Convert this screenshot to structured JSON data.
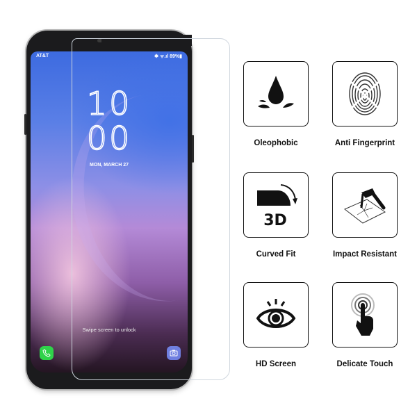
{
  "phone": {
    "carrier": "AT&T",
    "status_right": "✱ ᯤ.ıl 89%▮",
    "clock_hour": "10",
    "clock_minute": "00",
    "date": "MON, MARCH 27",
    "swipe_text": "Swipe screen to unlock",
    "apps": [
      "phone-icon",
      "camera-icon"
    ]
  },
  "features": [
    {
      "label": "Oleophobic",
      "icon": "oil-drop-icon"
    },
    {
      "label": "Anti Fingerprint",
      "icon": "fingerprint-icon"
    },
    {
      "label": "Curved Fit",
      "icon": "curved-3d-icon",
      "icon_text": "3D"
    },
    {
      "label": "Impact Resistant",
      "icon": "hammer-glass-icon"
    },
    {
      "label": "HD Screen",
      "icon": "eye-icon"
    },
    {
      "label": "Delicate Touch",
      "icon": "touch-finger-icon"
    }
  ],
  "colors": {
    "phone_app": "#2fd34a",
    "camera_app": "#6f7fe0",
    "icon_ink": "#111111"
  }
}
